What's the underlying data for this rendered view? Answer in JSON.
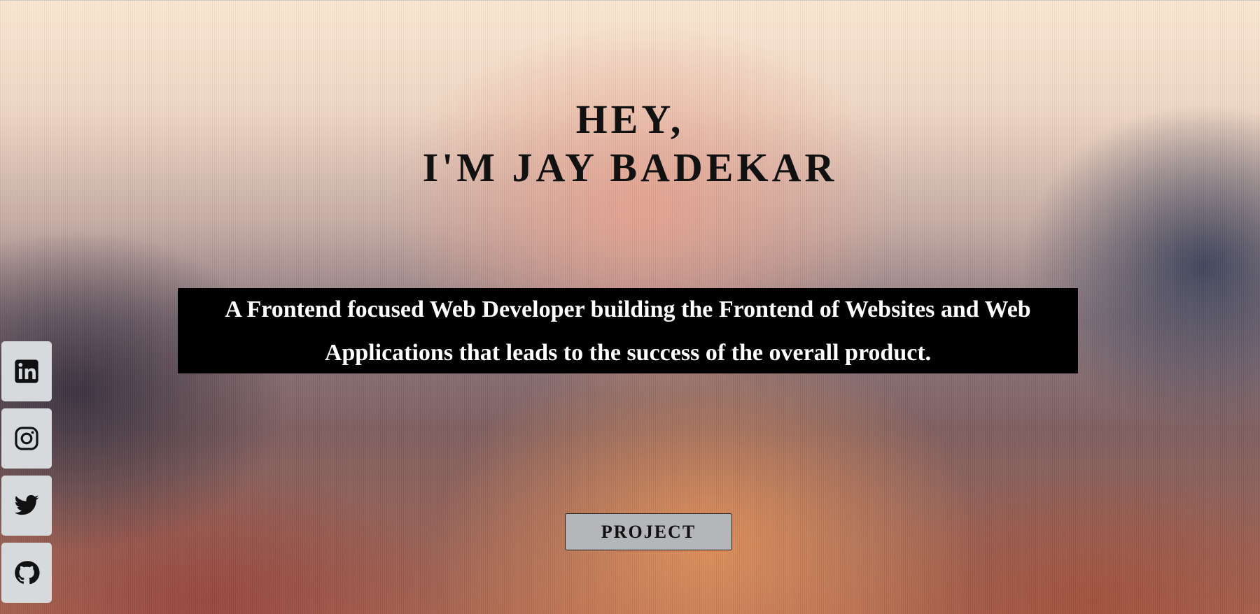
{
  "hero": {
    "greeting": "HEY,",
    "name": "I'M JAY BADEKAR"
  },
  "tagline": "A Frontend focused Web Developer building the Frontend of Websites and Web Applications that leads to the success of the overall product.",
  "project_button": {
    "label": "PROJECT"
  },
  "social_links": [
    {
      "icon": "linkedin-icon"
    },
    {
      "icon": "instagram-icon"
    },
    {
      "icon": "twitter-icon"
    },
    {
      "icon": "github-icon"
    }
  ],
  "colors": {
    "tagline_bg": "#000000",
    "tagline_text": "#ffffff",
    "button_bg": "#b4b6b9",
    "social_bg": "#d7dadc"
  }
}
